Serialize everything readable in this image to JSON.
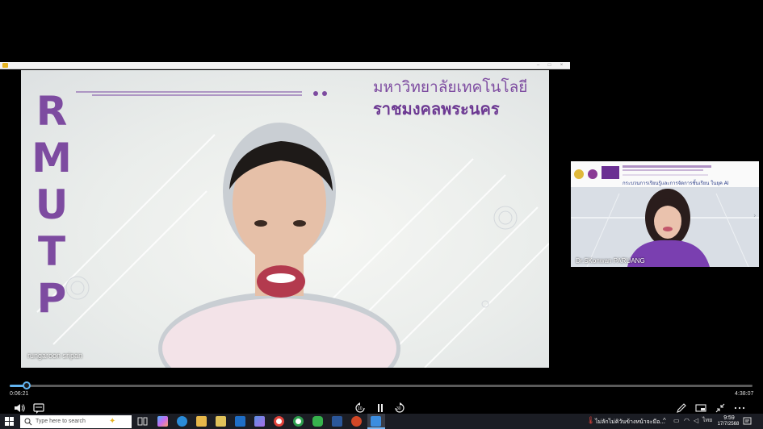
{
  "player": {
    "current_time": "0:06:21",
    "total_time": "4:38:07",
    "progress": 0.023,
    "skip_back_seconds": "10",
    "skip_forward_seconds": "30"
  },
  "main_video": {
    "logo_letters": [
      "R",
      "M",
      "U",
      "T",
      "P"
    ],
    "university_line1": "มหาวิทยาลัยเทคโนโลยี",
    "university_line2": "ราชมงคลพระนคร",
    "participant_name": "rungaroon sripan"
  },
  "side_video": {
    "slide_title": "กระบวนการเรียนรู้และการจัดการชั้นเรียน ในยุค AI",
    "participant_name": "Dr.SKonwan PARUANG"
  },
  "taskbar": {
    "search_placeholder": "Type here to search",
    "notification": "ไม่ลักไม่คิวันข้างหน้าจะมีอ...",
    "clock_time": "9:59",
    "clock_date": "17/7/2568",
    "input_language": "ไทย"
  },
  "colors": {
    "brand_purple": "#7d4ba0",
    "seek_accent": "#62b4f0",
    "taskbar_bg": "#1b1d24"
  }
}
